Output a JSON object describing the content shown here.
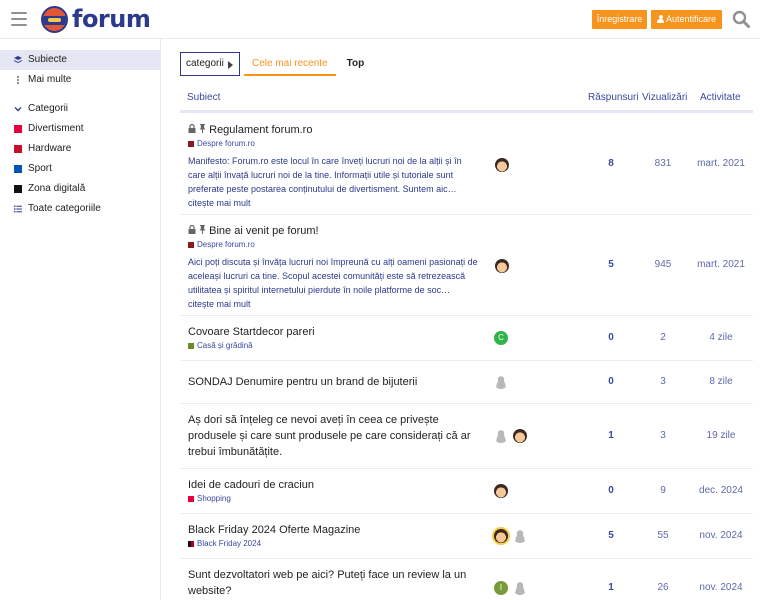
{
  "header": {
    "logo_text": "forum",
    "register_label": "Înregistrare",
    "login_label": "Autentificare"
  },
  "sidebar": {
    "items": [
      {
        "label": "Subiecte"
      },
      {
        "label": "Mai multe"
      }
    ],
    "categories_heading": "Categorii",
    "categories": [
      {
        "label": "Divertisment",
        "color": "#e4003a"
      },
      {
        "label": "Hardware",
        "color": "#c8102e"
      },
      {
        "label": "Sport",
        "color": "#0057b8"
      },
      {
        "label": "Zona digitală",
        "color": "#111111"
      }
    ],
    "all_categories": "Toate categoriile"
  },
  "nav": {
    "categories_dropdown": "categorii",
    "tabs": [
      {
        "label": "Cele mai recente"
      },
      {
        "label": "Top"
      }
    ]
  },
  "table": {
    "headers": {
      "subject": "Subiect",
      "replies": "Răspunsuri",
      "views": "Vizualizări",
      "activity": "Activitate"
    },
    "topics": [
      {
        "title": "Regulament forum.ro",
        "category": "Despre forum.ro",
        "category_color": "#8b1a1a",
        "excerpt": "Manifesto: Forum.ro este locul în care înveți lucruri noi de la alții și în care alții învață lucruri noi de la tine. Informații utile și tutoriale sunt preferate peste postarea conținutului de divertisment. Suntem aic… citește mai mult",
        "replies": "8",
        "views": "831",
        "activity": "mart. 2021"
      },
      {
        "title": "Bine ai venit pe forum!",
        "category": "Despre forum.ro",
        "category_color": "#8b1a1a",
        "excerpt": "Aici poți discuta și învăța lucruri noi împreună cu alți oameni pasionați de aceleași lucruri ca tine. Scopul acestei comunități este să retrezească utilitatea și spiritul internetului pierdute în noile platforme de soc… citește mai mult",
        "replies": "5",
        "views": "945",
        "activity": "mart. 2021"
      },
      {
        "title": "Covoare Startdecor pareri",
        "category": "Casă și grădină",
        "category_color": "#6b8e23",
        "replies": "0",
        "views": "2",
        "activity": "4 zile",
        "avatar_letter": "C"
      },
      {
        "title": "SONDAJ Denumire pentru un brand de bijuterii",
        "replies": "0",
        "views": "3",
        "activity": "8 zile"
      },
      {
        "title": "Aș dori să înțeleg ce nevoi aveți în ceea ce privește produsele și care sunt produsele pe care considerați că ar trebui îmbunătățite.",
        "replies": "1",
        "views": "3",
        "activity": "19 zile"
      },
      {
        "title": "Idei de cadouri de craciun",
        "category": "Shopping",
        "category_color": "#e4003a",
        "replies": "0",
        "views": "9",
        "activity": "dec. 2024"
      },
      {
        "title": "Black Friday 2024 Oferte Magazine",
        "category": "Black Friday 2024",
        "category_color": "#b3001b",
        "replies": "5",
        "views": "55",
        "activity": "nov. 2024"
      },
      {
        "title": "Sunt dezvoltatori web pe aici? Puteți face un review la un website?",
        "replies": "1",
        "views": "26",
        "activity": "nov. 2024",
        "avatar_letter": "I"
      }
    ]
  }
}
